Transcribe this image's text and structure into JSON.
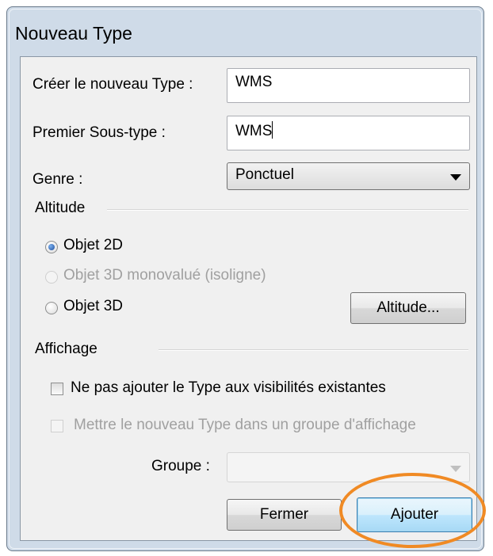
{
  "window": {
    "title": "Nouveau Type"
  },
  "form": {
    "new_type_label": "Créer le nouveau Type :",
    "new_type_value": "WMS",
    "first_subtype_label": "Premier Sous-type :",
    "first_subtype_value": "WMS",
    "genre_label": "Genre :",
    "genre_value": "Ponctuel"
  },
  "altitude": {
    "group_label": "Altitude",
    "options": [
      {
        "label": "Objet 2D",
        "checked": true,
        "enabled": true
      },
      {
        "label": "Objet 3D monovalué (isoligne)",
        "checked": false,
        "enabled": false
      },
      {
        "label": "Objet 3D",
        "checked": false,
        "enabled": true
      }
    ],
    "button_label": "Altitude..."
  },
  "affichage": {
    "group_label": "Affichage",
    "no_add_visibility_label": "Ne pas ajouter le Type aux visibilités existantes",
    "put_in_group_label": "Mettre le nouveau Type dans un groupe d'affichage",
    "groupe_label": "Groupe :",
    "groupe_value": ""
  },
  "buttons": {
    "close_label": "Fermer",
    "add_label": "Ajouter"
  },
  "colors": {
    "highlight_ellipse": "#f08a24",
    "default_button_border": "#3c7fb1"
  }
}
